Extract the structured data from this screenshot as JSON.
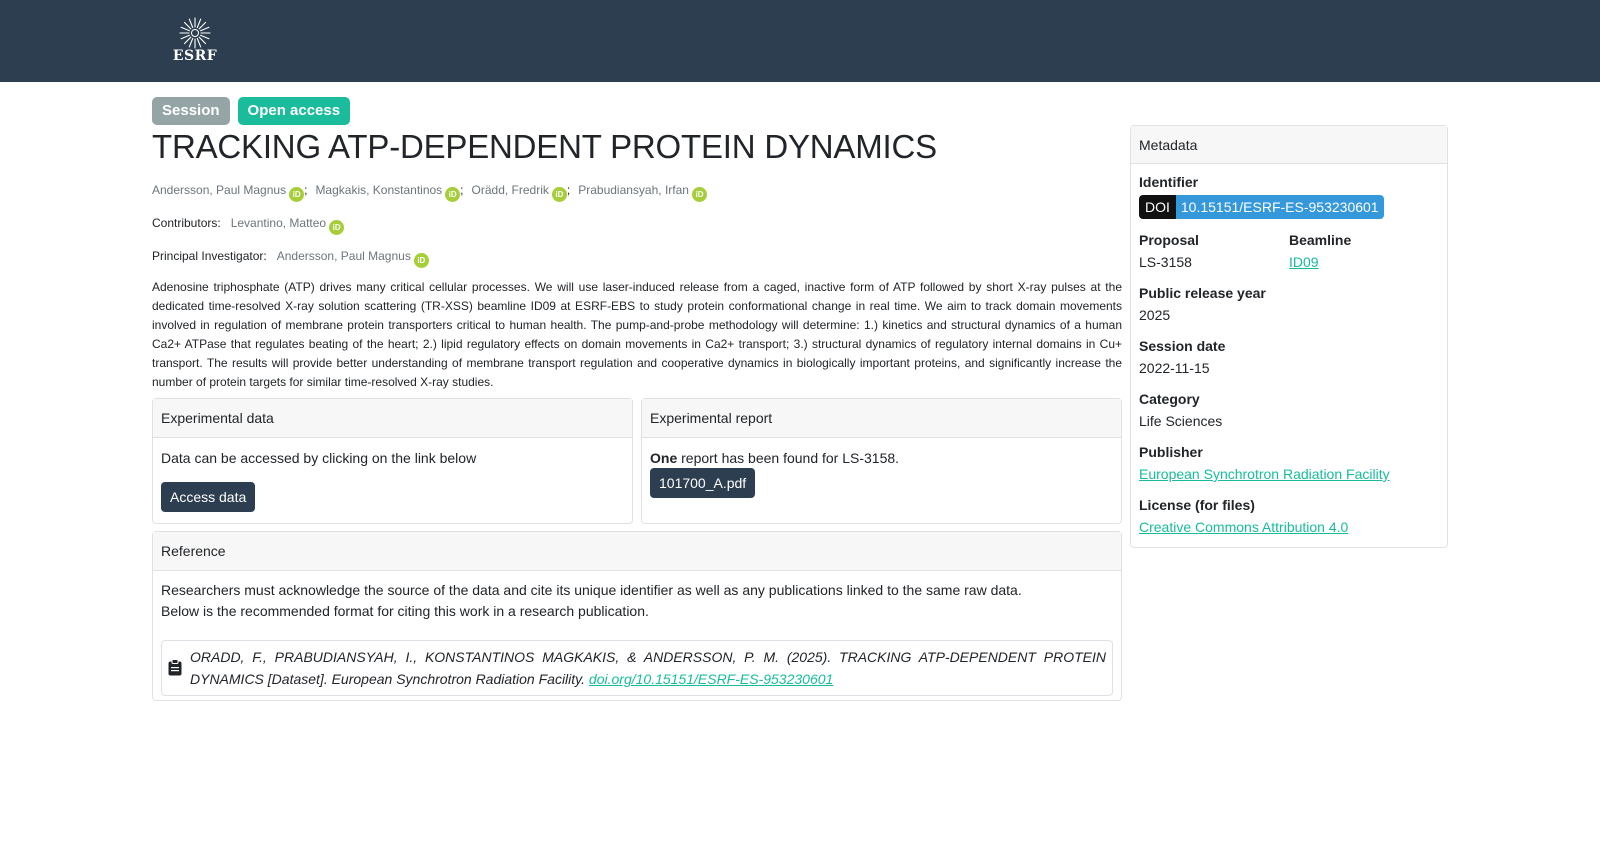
{
  "header": {
    "logo_text": "ESRF"
  },
  "badges": {
    "session": "Session",
    "open_access": "Open access"
  },
  "title": "TRACKING ATP-DEPENDENT PROTEIN DYNAMICS",
  "authors": [
    "Andersson, Paul Magnus",
    "Magkakis, Konstantinos",
    "Orädd, Fredrik",
    "Prabudiansyah, Irfan"
  ],
  "contributors": {
    "label": "Contributors:",
    "names": [
      "Levantino, Matteo"
    ]
  },
  "pi": {
    "label": "Principal Investigator:",
    "name": "Andersson, Paul Magnus"
  },
  "orcid_glyph": "iD",
  "abstract": "Adenosine triphosphate (ATP) drives many critical cellular processes. We will use laser-induced release from a caged, inactive form of ATP followed by short X-ray pulses at the dedicated time-resolved X-ray solution scattering (TR-XSS) beamline ID09 at ESRF-EBS to study protein conformational change in real time. We aim to track domain movements involved in regulation of membrane protein transporters critical to human health. The pump-and-probe methodology will determine: 1.) kinetics and structural dynamics of a human Ca2+ ATPase that regulates beating of the heart; 2.) lipid regulatory effects on domain movements in Ca2+ transport; 3.) structural dynamics of regulatory internal domains in Cu+ transport. The results will provide better understanding of membrane transport regulation and cooperative dynamics in biologically important proteins, and significantly increase the number of protein targets for similar time-resolved X-ray studies.",
  "experimental_data": {
    "heading": "Experimental data",
    "text": "Data can be accessed by clicking on the link below",
    "button": "Access data"
  },
  "experimental_report": {
    "heading": "Experimental report",
    "count_word": "One",
    "text": "report has been found for LS-3158.",
    "file_button": "101700_A.pdf"
  },
  "reference": {
    "heading": "Reference",
    "line1": "Researchers must acknowledge the source of the data and cite its unique identifier as well as any publications linked to the same raw data.",
    "line2": "Below is the recommended format for citing this work in a research publication.",
    "citation": "ORADD, F., PRABUDIANSYAH, I., KONSTANTINOS MAGKAKIS, & ANDERSSON, P. M. (2025). TRACKING ATP-DEPENDENT PROTEIN DYNAMICS [Dataset]. European Synchrotron Radiation Facility. ",
    "doi_link": "doi.org/10.15151/ESRF-ES-953230601"
  },
  "metadata": {
    "heading": "Metadata",
    "identifier_label": "Identifier",
    "doi_tag": "DOI",
    "doi_value": "10.15151/ESRF-ES-953230601",
    "proposal_label": "Proposal",
    "proposal": "LS-3158",
    "beamline_label": "Beamline",
    "beamline": "ID09",
    "release_label": "Public release year",
    "release": "2025",
    "session_label": "Session date",
    "session": "2022-11-15",
    "category_label": "Category",
    "category": "Life Sciences",
    "publisher_label": "Publisher",
    "publisher": "European Synchrotron Radiation Facility",
    "license_label": "License (for files)",
    "license": "Creative Commons Attribution 4.0"
  },
  "colors": {
    "navbar": "#2c3e50",
    "session_badge": "#95a5a6",
    "open_badge": "#1abc9c",
    "link": "#18bc9c",
    "doi_value_bg": "#3498db",
    "orcid": "#a6ce39"
  },
  "icons": {
    "orcid": "orcid-icon",
    "clipboard": "clipboard-icon",
    "logo": "esrf-logo"
  }
}
